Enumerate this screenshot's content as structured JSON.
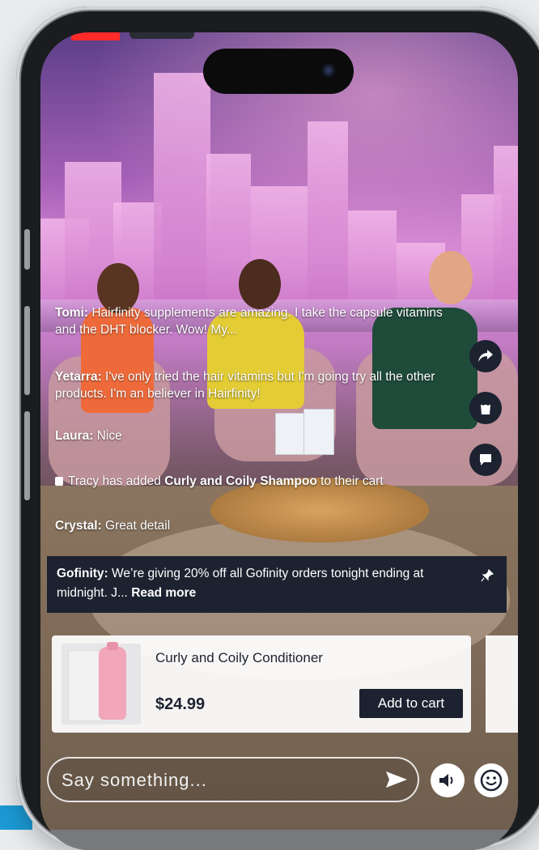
{
  "chat": [
    {
      "user": "Tomi:",
      "text": "Hairfinity supplements are amazing. I take the capsule vitamins and the DHT blocker. Wow! My..."
    },
    {
      "user": "Yetarra:",
      "text": "I've only tried the hair vitamins but I'm going try all the other products. I'm an believer in Hairfinity!"
    },
    {
      "user": "Laura:",
      "text": "Nice"
    },
    {
      "user": "Crystal:",
      "text": "Great detail"
    }
  ],
  "cart_event": {
    "prefix": "Tracy has added",
    "product": "Curly and Coily Shampoo",
    "suffix": "to their cart"
  },
  "pinned": {
    "user": "Gofinity:",
    "text": "We’re giving 20% off all Gofinity orders tonight ending at midnight. J...",
    "read_more": "Read more"
  },
  "product": {
    "name": "Curly and Coily Conditioner",
    "price": "$24.99",
    "button": "Add to cart"
  },
  "input": {
    "placeholder": "Say something..."
  },
  "icons": {
    "share": "share-icon",
    "bag": "shopping-bag-icon",
    "chat": "chat-bubble-icon",
    "pin": "pin-icon",
    "send": "send-icon",
    "sound": "speaker-icon",
    "emoji": "smiley-icon"
  },
  "colors": {
    "accent_dark": "#1c2230",
    "live_red": "#ff2a2a"
  }
}
